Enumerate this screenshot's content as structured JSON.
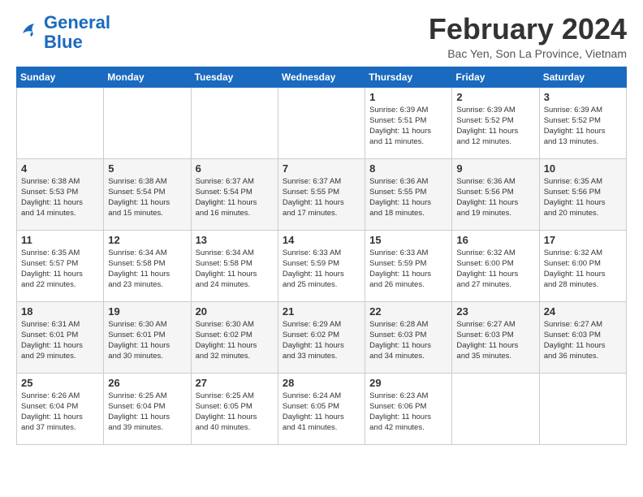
{
  "header": {
    "logo_line1": "General",
    "logo_line2": "Blue",
    "month_title": "February 2024",
    "location": "Bac Yen, Son La Province, Vietnam"
  },
  "days_of_week": [
    "Sunday",
    "Monday",
    "Tuesday",
    "Wednesday",
    "Thursday",
    "Friday",
    "Saturday"
  ],
  "weeks": [
    [
      {
        "day": "",
        "info": ""
      },
      {
        "day": "",
        "info": ""
      },
      {
        "day": "",
        "info": ""
      },
      {
        "day": "",
        "info": ""
      },
      {
        "day": "1",
        "info": "Sunrise: 6:39 AM\nSunset: 5:51 PM\nDaylight: 11 hours\nand 11 minutes."
      },
      {
        "day": "2",
        "info": "Sunrise: 6:39 AM\nSunset: 5:52 PM\nDaylight: 11 hours\nand 12 minutes."
      },
      {
        "day": "3",
        "info": "Sunrise: 6:39 AM\nSunset: 5:52 PM\nDaylight: 11 hours\nand 13 minutes."
      }
    ],
    [
      {
        "day": "4",
        "info": "Sunrise: 6:38 AM\nSunset: 5:53 PM\nDaylight: 11 hours\nand 14 minutes."
      },
      {
        "day": "5",
        "info": "Sunrise: 6:38 AM\nSunset: 5:54 PM\nDaylight: 11 hours\nand 15 minutes."
      },
      {
        "day": "6",
        "info": "Sunrise: 6:37 AM\nSunset: 5:54 PM\nDaylight: 11 hours\nand 16 minutes."
      },
      {
        "day": "7",
        "info": "Sunrise: 6:37 AM\nSunset: 5:55 PM\nDaylight: 11 hours\nand 17 minutes."
      },
      {
        "day": "8",
        "info": "Sunrise: 6:36 AM\nSunset: 5:55 PM\nDaylight: 11 hours\nand 18 minutes."
      },
      {
        "day": "9",
        "info": "Sunrise: 6:36 AM\nSunset: 5:56 PM\nDaylight: 11 hours\nand 19 minutes."
      },
      {
        "day": "10",
        "info": "Sunrise: 6:35 AM\nSunset: 5:56 PM\nDaylight: 11 hours\nand 20 minutes."
      }
    ],
    [
      {
        "day": "11",
        "info": "Sunrise: 6:35 AM\nSunset: 5:57 PM\nDaylight: 11 hours\nand 22 minutes."
      },
      {
        "day": "12",
        "info": "Sunrise: 6:34 AM\nSunset: 5:58 PM\nDaylight: 11 hours\nand 23 minutes."
      },
      {
        "day": "13",
        "info": "Sunrise: 6:34 AM\nSunset: 5:58 PM\nDaylight: 11 hours\nand 24 minutes."
      },
      {
        "day": "14",
        "info": "Sunrise: 6:33 AM\nSunset: 5:59 PM\nDaylight: 11 hours\nand 25 minutes."
      },
      {
        "day": "15",
        "info": "Sunrise: 6:33 AM\nSunset: 5:59 PM\nDaylight: 11 hours\nand 26 minutes."
      },
      {
        "day": "16",
        "info": "Sunrise: 6:32 AM\nSunset: 6:00 PM\nDaylight: 11 hours\nand 27 minutes."
      },
      {
        "day": "17",
        "info": "Sunrise: 6:32 AM\nSunset: 6:00 PM\nDaylight: 11 hours\nand 28 minutes."
      }
    ],
    [
      {
        "day": "18",
        "info": "Sunrise: 6:31 AM\nSunset: 6:01 PM\nDaylight: 11 hours\nand 29 minutes."
      },
      {
        "day": "19",
        "info": "Sunrise: 6:30 AM\nSunset: 6:01 PM\nDaylight: 11 hours\nand 30 minutes."
      },
      {
        "day": "20",
        "info": "Sunrise: 6:30 AM\nSunset: 6:02 PM\nDaylight: 11 hours\nand 32 minutes."
      },
      {
        "day": "21",
        "info": "Sunrise: 6:29 AM\nSunset: 6:02 PM\nDaylight: 11 hours\nand 33 minutes."
      },
      {
        "day": "22",
        "info": "Sunrise: 6:28 AM\nSunset: 6:03 PM\nDaylight: 11 hours\nand 34 minutes."
      },
      {
        "day": "23",
        "info": "Sunrise: 6:27 AM\nSunset: 6:03 PM\nDaylight: 11 hours\nand 35 minutes."
      },
      {
        "day": "24",
        "info": "Sunrise: 6:27 AM\nSunset: 6:03 PM\nDaylight: 11 hours\nand 36 minutes."
      }
    ],
    [
      {
        "day": "25",
        "info": "Sunrise: 6:26 AM\nSunset: 6:04 PM\nDaylight: 11 hours\nand 37 minutes."
      },
      {
        "day": "26",
        "info": "Sunrise: 6:25 AM\nSunset: 6:04 PM\nDaylight: 11 hours\nand 39 minutes."
      },
      {
        "day": "27",
        "info": "Sunrise: 6:25 AM\nSunset: 6:05 PM\nDaylight: 11 hours\nand 40 minutes."
      },
      {
        "day": "28",
        "info": "Sunrise: 6:24 AM\nSunset: 6:05 PM\nDaylight: 11 hours\nand 41 minutes."
      },
      {
        "day": "29",
        "info": "Sunrise: 6:23 AM\nSunset: 6:06 PM\nDaylight: 11 hours\nand 42 minutes."
      },
      {
        "day": "",
        "info": ""
      },
      {
        "day": "",
        "info": ""
      }
    ]
  ]
}
